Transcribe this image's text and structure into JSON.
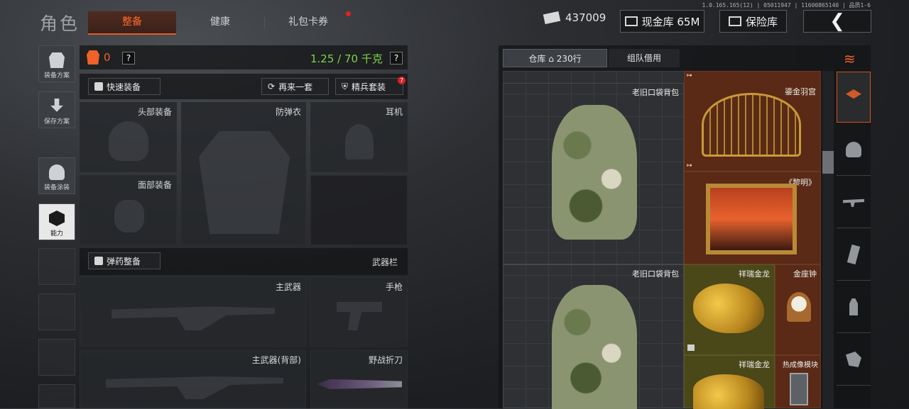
{
  "version": "1.0.165.165(12) | 05011947 | 11600865140 | 品质1-6",
  "header": {
    "title": "角色",
    "tabs": [
      {
        "label": "整备",
        "active": true
      },
      {
        "label": "健康",
        "active": false
      },
      {
        "label": "礼包卡券",
        "active": false,
        "notification": true
      }
    ],
    "money": "437009",
    "cash_warehouse_label": "现金库 65M",
    "safe_label": "保险库"
  },
  "rail": [
    {
      "label": "装备方案",
      "icon": "vest-icon"
    },
    {
      "label": "保存方案",
      "icon": "download-icon"
    },
    {
      "label": "装备涂装",
      "icon": "paint-helmet-icon"
    },
    {
      "label": "能力",
      "icon": "ability-icon",
      "active": true
    }
  ],
  "equip": {
    "count": "0",
    "weight": "1.25 / 70 千克",
    "help": "?",
    "quick_equip": "快速装备",
    "again": "再来一套",
    "elite": "精兵套装",
    "elite_badge": "7",
    "slots": {
      "helmet": "头部装备",
      "armor": "防弹衣",
      "headset": "耳机",
      "face": "面部装备"
    },
    "ammo_button": "弹药整备",
    "weapon_bar": "武器栏",
    "weapons": {
      "primary": "主武器",
      "pistol": "手枪",
      "primary_back": "主武器(背部)",
      "knife": "野战折刀"
    }
  },
  "warehouse": {
    "tab_warehouse": "仓库",
    "rows": "230行",
    "tab_team": "组队借用",
    "items": [
      {
        "name": "老旧口袋背包"
      },
      {
        "name": "鎏金羽宫"
      },
      {
        "name": "《黎明》"
      },
      {
        "name": "老旧口袋背包"
      },
      {
        "name": "祥瑞金龙"
      },
      {
        "name": "金座钟"
      },
      {
        "name": "祥瑞金龙"
      },
      {
        "name": "热成像模块"
      }
    ]
  },
  "colors": {
    "accent": "#f0622a",
    "weight": "#7dd44a",
    "rare_bg": "#5a2a16",
    "gold_bg": "#4a4718"
  }
}
